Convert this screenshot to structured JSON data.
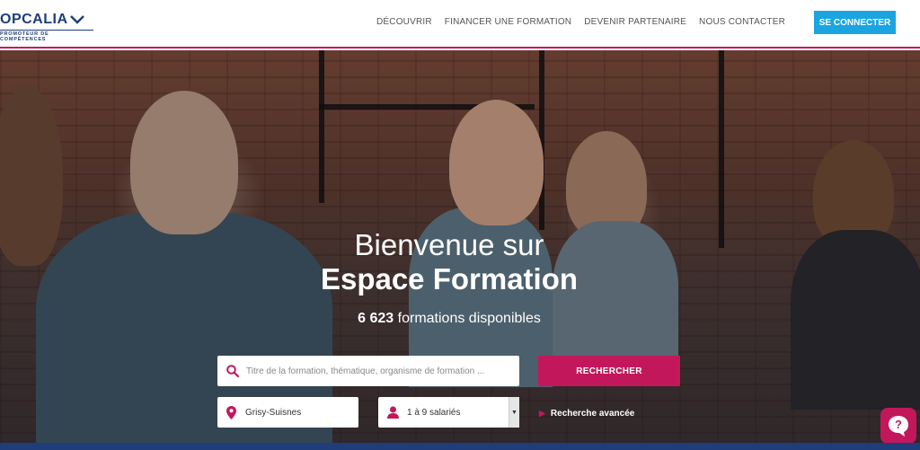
{
  "header": {
    "logo_name": "OPCALIA",
    "logo_tagline": "PROMOTEUR DE COMPÉTENCES",
    "nav": [
      "DÉCOUVRIR",
      "FINANCER UNE FORMATION",
      "DEVENIR PARTENAIRE",
      "NOUS CONTACTER"
    ],
    "connect_label": "SE CONNECTER"
  },
  "hero": {
    "title_line1": "Bienvenue sur",
    "title_line2": "Espace Formation",
    "count_number": "6 623",
    "count_suffix": " formations disponibles"
  },
  "search": {
    "placeholder": "Titre de la formation, thématique, organisme de formation ...",
    "button_label": "RECHERCHER",
    "location_value": "Grisy-Suisnes",
    "company_size_value": "1 à 9 salariés",
    "advanced_label": "Recherche avancée"
  },
  "colors": {
    "brand_pink": "#c2185b",
    "brand_blue": "#1f3d7a",
    "connect_blue": "#1ba5e0"
  },
  "icons": [
    "search-icon",
    "location-pin-icon",
    "user-icon",
    "chevron-down-icon",
    "chevron-right-icon",
    "help-chat-icon"
  ]
}
